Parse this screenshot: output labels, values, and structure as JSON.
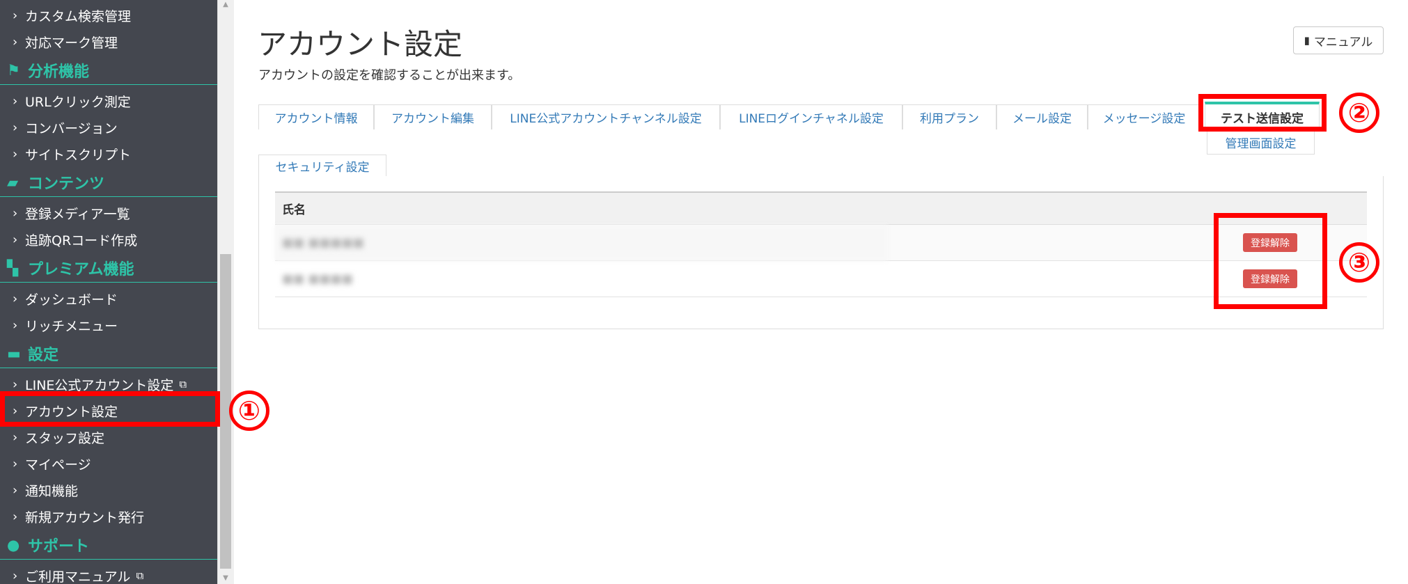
{
  "sidebar": {
    "items_top": [
      {
        "label": "カスタム検索管理"
      },
      {
        "label": "対応マーク管理"
      }
    ],
    "sections": [
      {
        "title": "分析機能",
        "icon": "flag-icon",
        "items": [
          {
            "label": "URLクリック測定"
          },
          {
            "label": "コンバージョン"
          },
          {
            "label": "サイトスクリプト"
          }
        ]
      },
      {
        "title": "コンテンツ",
        "icon": "folder-open-icon",
        "items": [
          {
            "label": "登録メディア一覧"
          },
          {
            "label": "追跡QRコード作成"
          }
        ]
      },
      {
        "title": "プレミアム機能",
        "icon": "gift-icon",
        "items": [
          {
            "label": "ダッシュボード"
          },
          {
            "label": "リッチメニュー"
          }
        ]
      },
      {
        "title": "設定",
        "icon": "comment-icon",
        "items": [
          {
            "label": "LINE公式アカウント設定",
            "external": true
          },
          {
            "label": "アカウント設定"
          },
          {
            "label": "スタッフ設定"
          },
          {
            "label": "マイページ"
          },
          {
            "label": "通知機能"
          },
          {
            "label": "新規アカウント発行"
          }
        ]
      },
      {
        "title": "サポート",
        "icon": "question-circle-icon",
        "items": [
          {
            "label": "ご利用マニュアル",
            "external": true
          }
        ]
      }
    ]
  },
  "main": {
    "title": "アカウント設定",
    "description": "アカウントの設定を確認することが出来ます。",
    "manual_button": "マニュアル",
    "tabs": [
      {
        "label": "アカウント情報"
      },
      {
        "label": "アカウント編集"
      },
      {
        "label": "LINE公式アカウントチャンネル設定"
      },
      {
        "label": "LINEログインチャネル設定"
      },
      {
        "label": "利用プラン"
      },
      {
        "label": "メール設定"
      },
      {
        "label": "メッセージ設定"
      },
      {
        "label": "テスト送信設定",
        "active": true
      },
      {
        "label": "管理画面設定"
      },
      {
        "label": "セキュリティ設定"
      }
    ],
    "table": {
      "header": "氏名",
      "rows": [
        {
          "name": "■■ ■■■■■",
          "action": "登録解除"
        },
        {
          "name": "■■ ■■■■",
          "action": "登録解除"
        }
      ]
    }
  },
  "annotations": {
    "marker_1": "①",
    "marker_2": "②",
    "marker_3": "③",
    "color": "#ff0000"
  },
  "colors": {
    "sidebar_bg": "#44474f",
    "accent": "#2ec4a8",
    "link": "#337ab7",
    "danger": "#d9534f"
  }
}
